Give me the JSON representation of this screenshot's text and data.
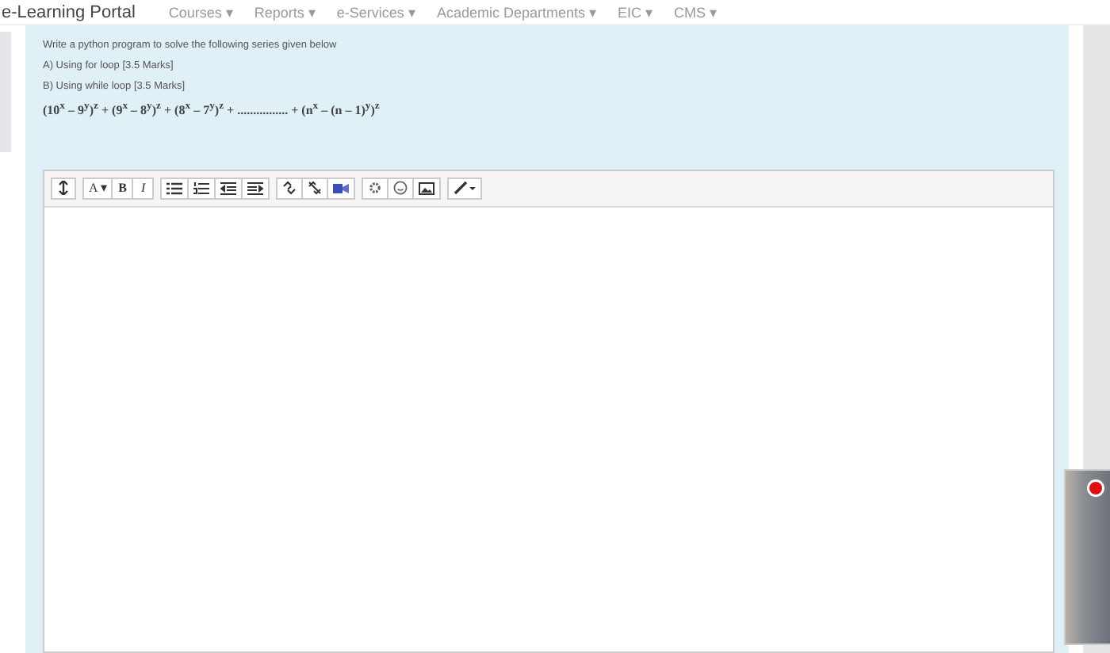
{
  "nav": {
    "brand": "e-Learning Portal",
    "menus": [
      "Courses ▾",
      "Reports ▾",
      "e-Services ▾",
      "Academic Departments ▾",
      "EIC ▾",
      "CMS ▾"
    ]
  },
  "question": {
    "lines": [
      "Write a python program to solve the following series given below",
      "A) Using for loop [3.5 Marks]",
      "B) Using while loop [3.5 Marks]"
    ],
    "formula": "(10$^{x}$ – 9$^{y}$)$^{z}$ + (9$^{x}$ – 8$^{y}$)$^{z}$ + (8$^{x}$ – 7$^{y}$)$^{z}$ + ................ + (n$^{x}$ – (n – 1)$^{y}$)$^{z}$"
  },
  "toolbar": {
    "font": "A ▾",
    "bold": "B",
    "italic": "I"
  }
}
